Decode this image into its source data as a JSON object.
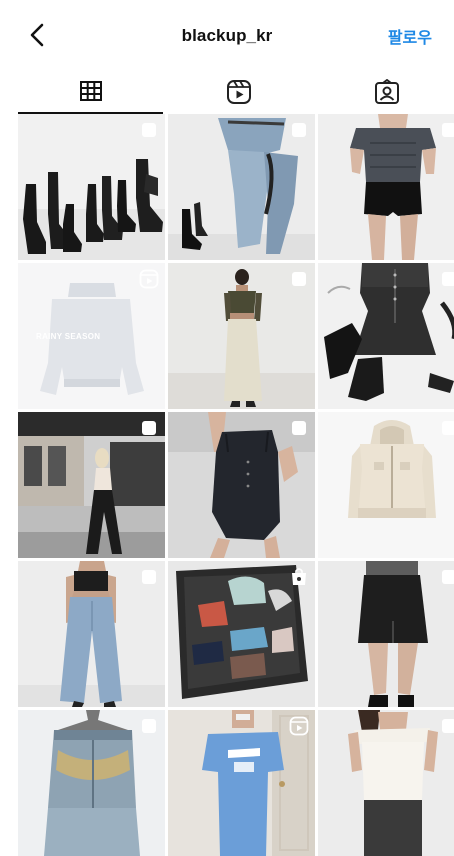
{
  "header": {
    "username": "blackup_kr",
    "follow_label": "팔로우"
  },
  "tabs": [
    {
      "name": "grid",
      "icon": "grid-icon",
      "active": true
    },
    {
      "name": "reels",
      "icon": "reels-icon",
      "active": false
    },
    {
      "name": "tagged",
      "icon": "tagged-icon",
      "active": false
    }
  ],
  "posts": [
    {
      "subject": "black boots set",
      "badge": "carousel"
    },
    {
      "subject": "denim jeans with heels",
      "badge": "carousel"
    },
    {
      "subject": "grey top black shorts",
      "badge": "carousel"
    },
    {
      "subject": "rainy season sweatshirt",
      "badge": "reel",
      "print": "RAINY SEASON"
    },
    {
      "subject": "cream cargo skirt outfit",
      "badge": "carousel"
    },
    {
      "subject": "denim mini dress with boots",
      "badge": "carousel"
    },
    {
      "subject": "wide leg pants street",
      "badge": "carousel"
    },
    {
      "subject": "navy mini dress mirror selfie",
      "badge": "carousel"
    },
    {
      "subject": "beige zip hoodie",
      "badge": "carousel"
    },
    {
      "subject": "light wide jeans",
      "badge": "carousel"
    },
    {
      "subject": "swimwear flat lay",
      "badge": "shopping"
    },
    {
      "subject": "black mini skirt",
      "badge": "carousel"
    },
    {
      "subject": "vintage wash jeans on hanger",
      "badge": "carousel"
    },
    {
      "subject": "blue jersey mirror selfie",
      "badge": "reel"
    },
    {
      "subject": "white off-shoulder top",
      "badge": "carousel"
    }
  ]
}
